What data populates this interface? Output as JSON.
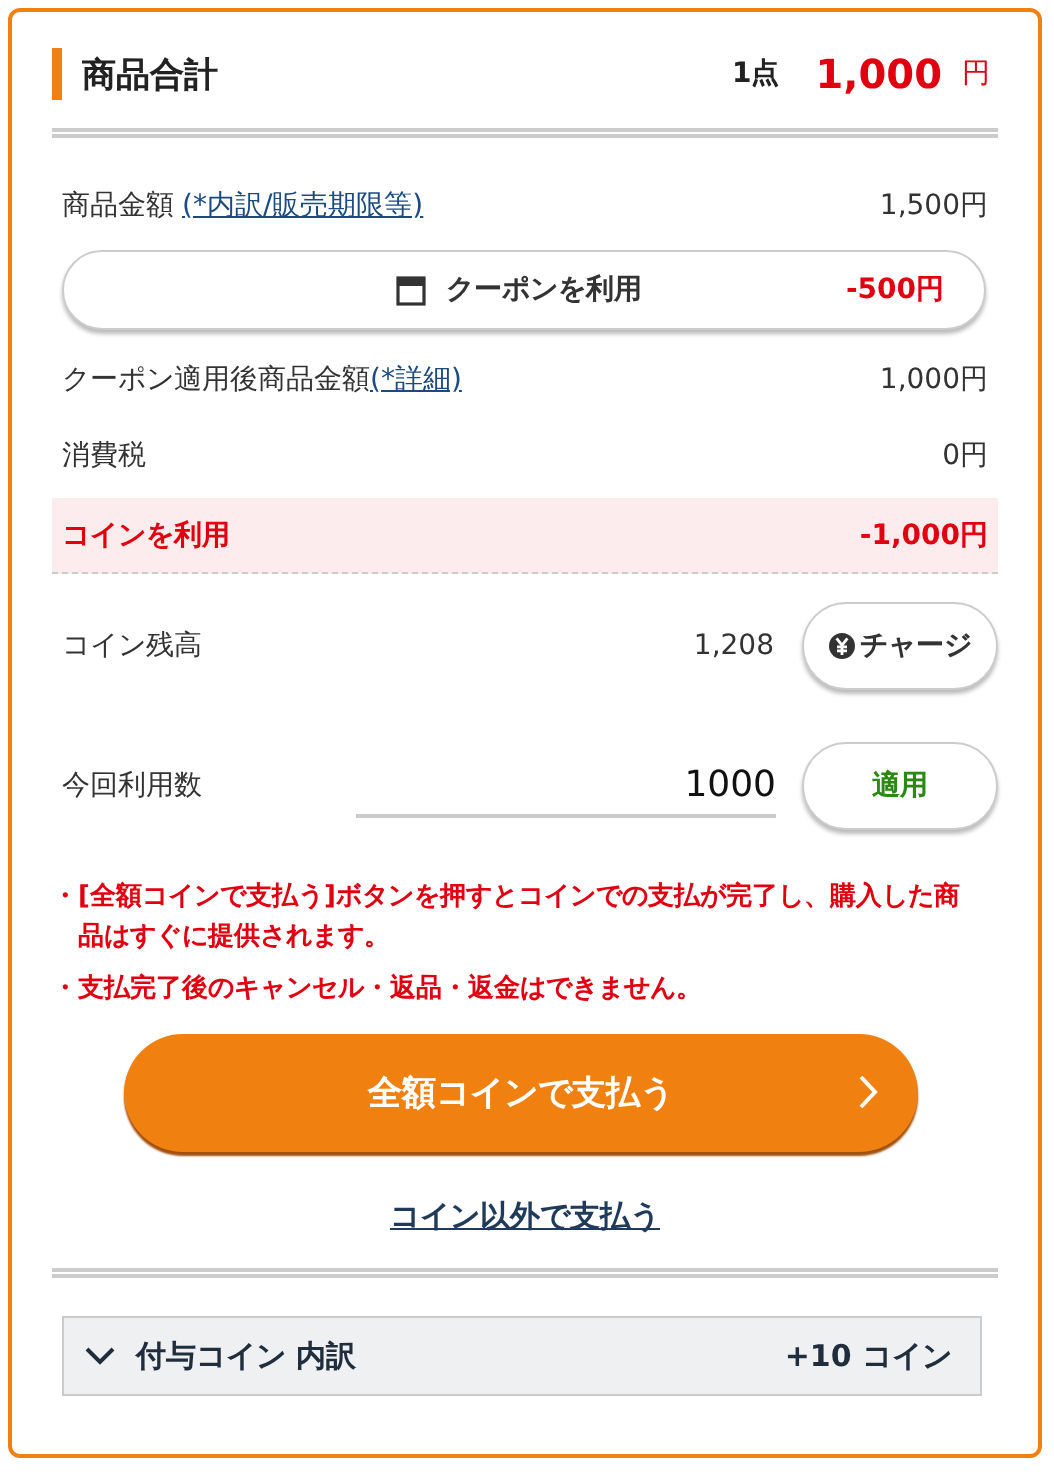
{
  "header": {
    "title": "商品合計",
    "count": "1点",
    "total": "1,000",
    "unit": "円"
  },
  "rows": [
    {
      "kind": "line",
      "label": "商品金額",
      "link": "(*内訳/販売期限等)",
      "value": "1,500円"
    },
    {
      "kind": "coupon",
      "label": "クーポンを利用",
      "value": "-500円"
    },
    {
      "kind": "line",
      "label": "クーポン適用後商品金額",
      "link": "(*詳細)",
      "value": "1,000円"
    },
    {
      "kind": "line",
      "label": "消費税",
      "value": "0円"
    },
    {
      "kind": "highlight",
      "label": "コインを利用",
      "value": "-1,000円"
    }
  ],
  "balance": {
    "label": "コイン残高",
    "value": "1,208",
    "button": "チャージ"
  },
  "usage": {
    "label": "今回利用数",
    "value": "1000",
    "button": "適用"
  },
  "notes": [
    "・[全額コインで支払う]ボタンを押すとコインでの支払が完了し、購入した商品はすぐに提供されます。",
    "・支払完了後のキャンセル・返品・返金はできません。"
  ],
  "pay_button": "全額コインで支払う",
  "other_link": "コイン以外で支払う",
  "bonus": {
    "label": "付与コイン 内訳",
    "value": "+10 コイン",
    "expanded": false
  }
}
